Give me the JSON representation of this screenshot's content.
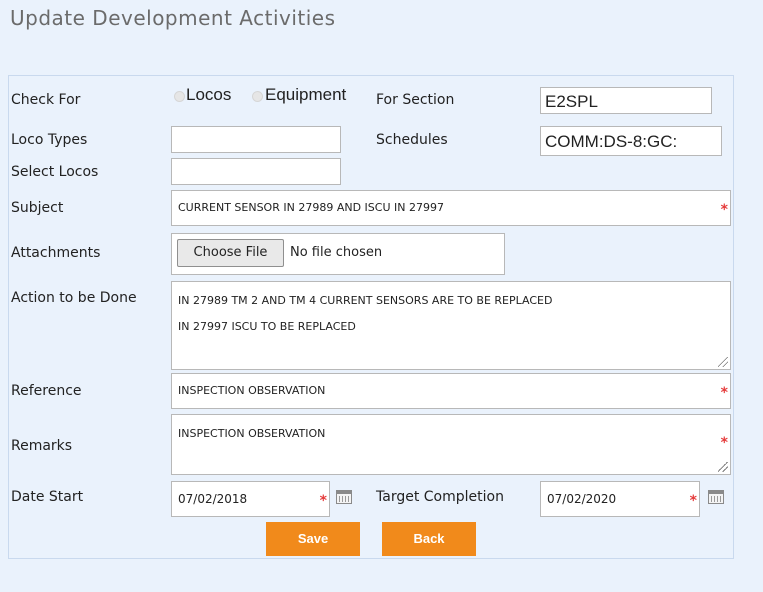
{
  "page": {
    "title": "Update Development Activities"
  },
  "form": {
    "check_for": {
      "label": "Check For",
      "options": [
        "Locos",
        "Equipment"
      ]
    },
    "for_section": {
      "label": "For Section",
      "value": "E2SPL"
    },
    "loco_types": {
      "label": "Loco Types",
      "value": ""
    },
    "schedules": {
      "label": "Schedules",
      "value": "COMM:DS-8:GC:"
    },
    "select_locos": {
      "label": "Select Locos",
      "value": ""
    },
    "subject": {
      "label": "Subject",
      "value": "CURRENT SENSOR IN 27989 AND ISCU IN 27997"
    },
    "attachments": {
      "label": "Attachments",
      "button": "Choose File",
      "status": "No file chosen"
    },
    "action": {
      "label": "Action to be Done",
      "lines": [
        "IN 27989 TM 2 AND TM 4 CURRENT SENSORS ARE TO BE REPLACED",
        "IN 27997 ISCU TO BE REPLACED"
      ]
    },
    "reference": {
      "label": "Reference",
      "value": "INSPECTION OBSERVATION"
    },
    "remarks": {
      "label": "Remarks",
      "value": "INSPECTION OBSERVATION"
    },
    "date_start": {
      "label": "Date Start",
      "value": "07/02/2018"
    },
    "target_completion": {
      "label": "Target Completion",
      "value": "07/02/2020"
    },
    "required_marker": "*"
  },
  "buttons": {
    "save": "Save",
    "back": "Back"
  },
  "colors": {
    "accent": "#f18a1b",
    "required": "#e53a3a",
    "background": "#eaf2fc"
  }
}
